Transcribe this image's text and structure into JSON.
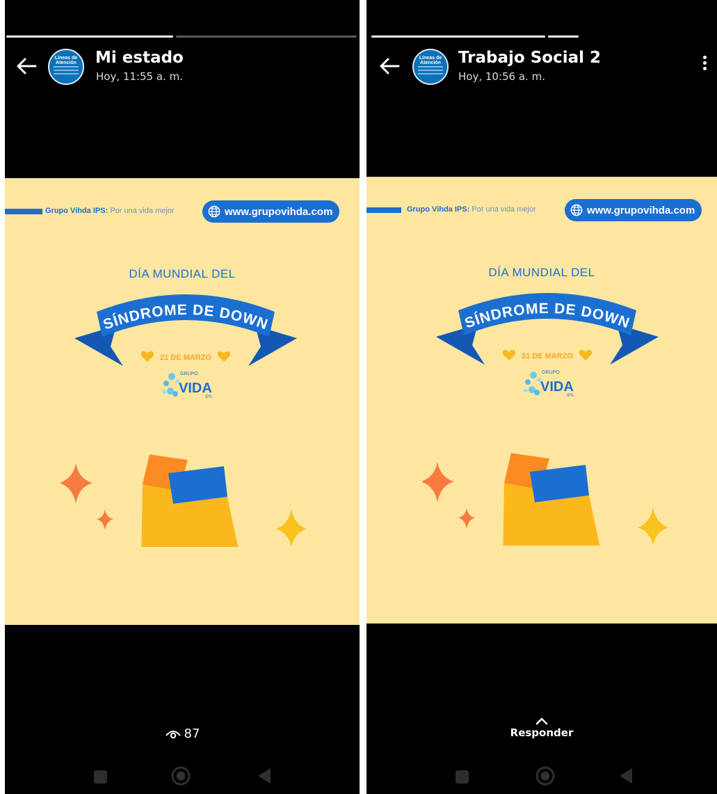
{
  "left_status": {
    "title": "Mi estado",
    "time": "Hoy, 11:55 a. m.",
    "views": "87",
    "avatar_text": "Líneas de Atención",
    "progress_fractions": [
      1.0,
      0.0
    ]
  },
  "right_status": {
    "title": "Trabajo Social 2",
    "time": "Hoy, 10:56 a. m.",
    "reply_label": "Responder",
    "avatar_text": "Líneas de Atención",
    "progress_fractions": [
      1.0,
      1.0
    ]
  },
  "poster": {
    "brand": "Grupo Vihda IPS:",
    "slogan": "Por una vida mejor",
    "url": "www.grupovihda.com",
    "line1": "DÍA MUNDIAL DEL",
    "banner": "SÍNDROME DE DOWN",
    "date": "21 DE MARZO",
    "logo_top": "GRUPO",
    "logo_main": "VIDA",
    "logo_sub": "IPS"
  },
  "colors": {
    "poster_bg": "#fde6a0",
    "brand_blue": "#1b6fd1",
    "sock_orange": "#fb8a23",
    "sock_yellow": "#fbb81c",
    "sparkle_orange": "#f77b3e",
    "sparkle_yellow": "#f9c21f"
  },
  "icons": {
    "back": "arrow-left-icon",
    "menu": "more-vert-icon",
    "views": "eye-icon",
    "reply": "chevron-up-icon",
    "globe": "globe-icon",
    "nav": [
      "square-icon",
      "circle-icon",
      "triangle-back-icon"
    ]
  }
}
